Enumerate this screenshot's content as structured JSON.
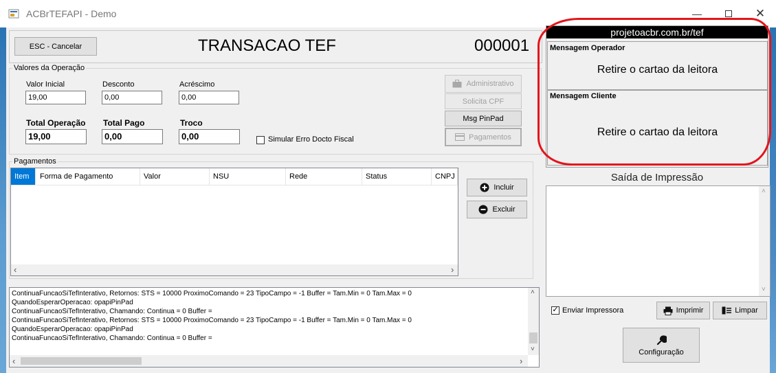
{
  "window": {
    "title": "ACBrTEFAPI - Demo"
  },
  "header": {
    "esc_label": "ESC - Cancelar",
    "title": "TRANSACAO TEF",
    "number": "000001"
  },
  "valores": {
    "group_label": "Valores da Operação",
    "valor_inicial_label": "Valor Inicial",
    "valor_inicial": "19,00",
    "desconto_label": "Desconto",
    "desconto": "0,00",
    "acrescimo_label": "Acréscimo",
    "acrescimo": "0,00",
    "total_operacao_label": "Total Operação",
    "total_operacao": "19,00",
    "total_pago_label": "Total Pago",
    "total_pago": "0,00",
    "troco_label": "Troco",
    "troco": "0,00",
    "simular_label": "Simular Erro Docto Fiscal"
  },
  "actions": {
    "administrativo": "Administrativo",
    "solicita_cpf": "Solicita CPF",
    "msg_pinpad": "Msg PinPad",
    "pagamentos": "Pagamentos"
  },
  "pagamentos": {
    "group_label": "Pagamentos",
    "columns": [
      "Item",
      "Forma de Pagamento",
      "Valor",
      "NSU",
      "Rede",
      "Status",
      "CNPJ C"
    ],
    "incluir": "Incluir",
    "excluir": "Excluir"
  },
  "log": {
    "lines": [
      "ContinuaFuncaoSiTefInterativo,  Retornos: STS = 10000 ProximoComando = 23 TipoCampo = -1 Buffer =  Tam.Min = 0 Tam.Max = 0",
      "QuandoEsperarOperacao: opapiPinPad",
      "ContinuaFuncaoSiTefInterativo, Chamando: Continua = 0 Buffer =",
      "ContinuaFuncaoSiTefInterativo,  Retornos: STS = 10000 ProximoComando = 23 TipoCampo = -1 Buffer =  Tam.Min = 0 Tam.Max = 0",
      "QuandoEsperarOperacao: opapiPinPad",
      "ContinuaFuncaoSiTefInterativo, Chamando: Continua = 0 Buffer ="
    ]
  },
  "right": {
    "banner": "projetoacbr.com.br/tef",
    "msg_operador_label": "Mensagem Operador",
    "msg_operador": "Retire o cartao da leitora",
    "msg_cliente_label": "Mensagem Cliente",
    "msg_cliente": "Retire o cartao da leitora",
    "saida_label": "Saída de Impressão",
    "enviar_label": "Enviar Impressora",
    "imprimir": "Imprimir",
    "limpar": "Limpar",
    "configuracao": "Configuração"
  },
  "colors": {
    "accent": "#0078d7",
    "annotation": "#e4141b",
    "banner_bg": "#000000"
  },
  "icons": [
    "app-icon",
    "minimize-icon",
    "maximize-icon",
    "close-icon",
    "briefcase-icon",
    "card-icon",
    "plus-circle-icon",
    "minus-circle-icon",
    "printer-icon",
    "eraser-icon",
    "wrench-icon"
  ]
}
